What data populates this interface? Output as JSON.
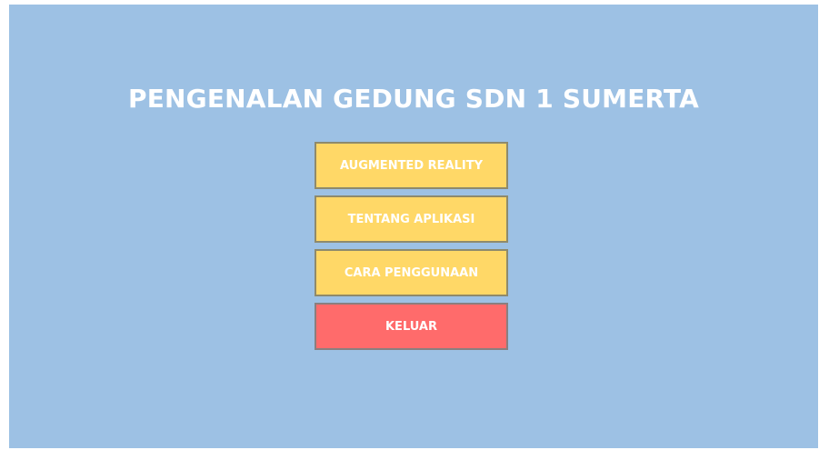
{
  "app": {
    "title": "PENGENALAN GEDUNG SDN 1 SUMERTA"
  },
  "menu": {
    "buttons": [
      {
        "label": "AUGMENTED REALITY",
        "color": "#ffd867"
      },
      {
        "label": "TENTANG APLIKASI",
        "color": "#ffd867"
      },
      {
        "label": "CARA PENGGUNAAN",
        "color": "#ffd867"
      },
      {
        "label": "KELUAR",
        "color": "#ff6b6b"
      }
    ]
  },
  "theme": {
    "background": "#9dc1e4",
    "text": "#ffffff"
  }
}
